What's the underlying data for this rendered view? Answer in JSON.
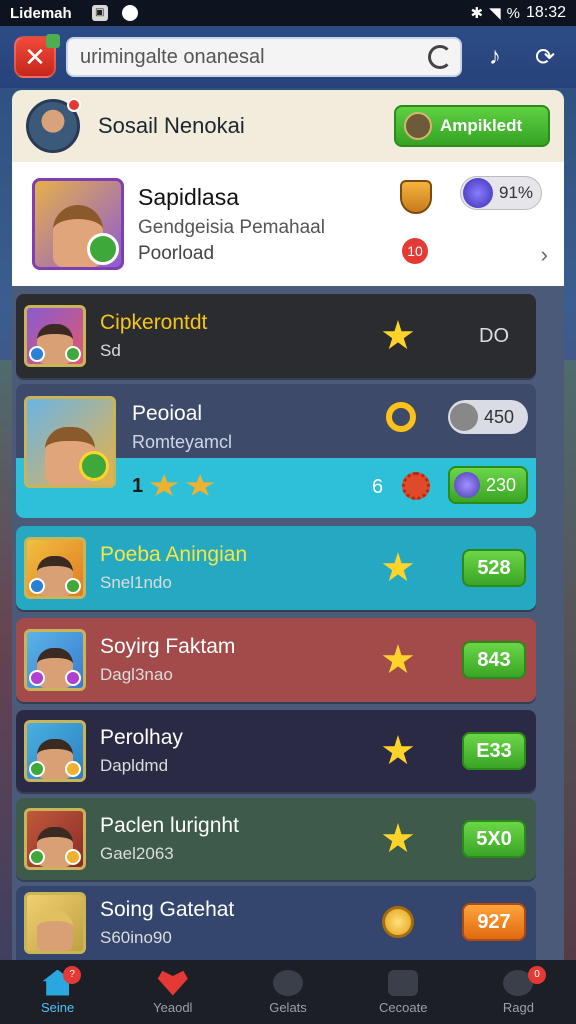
{
  "status_bar": {
    "carrier": "Lidemah",
    "battery_text": "%",
    "time": "18:32"
  },
  "topbar": {
    "search_value": "urimingalte onanesal"
  },
  "profile": {
    "name": "Sosail Nenokai",
    "action_label": "Ampikledt"
  },
  "featured": {
    "title": "Sapidlasa",
    "subtitle": "Gendgeisia Pemahaal",
    "status": "Poorload",
    "pill_value": "91%",
    "badge_count": "10"
  },
  "rows": [
    {
      "title": "Cipkerontdt",
      "subtitle": "Sd",
      "score": "DO",
      "icon": "star-icon",
      "title_color": "#f5c518",
      "bg": "#2a2c30"
    },
    {
      "title": "Poeba Aningian",
      "subtitle": "Snel1ndo",
      "score": "528",
      "icon": "star-icon",
      "title_color": "#f5e642",
      "bg": "#25a9c2"
    },
    {
      "title": "Soyirg Faktam",
      "subtitle": "Dagl3nao",
      "score": "843",
      "icon": "star-icon",
      "title_color": "#ffffff",
      "bg": "#a34a4a"
    },
    {
      "title": "Perolhay",
      "subtitle": "Dapldmd",
      "score": "E33",
      "icon": "star-icon",
      "title_color": "#ffffff",
      "bg": "#2b2a45"
    },
    {
      "title": "Paclen lurignht",
      "subtitle": "Gael2063",
      "score": "5X0",
      "icon": "star-icon",
      "title_color": "#ffffff",
      "bg": "#3d5a4a"
    },
    {
      "title": "Soing Gatehat",
      "subtitle": "S60ino90",
      "score": "927",
      "icon": "coin-icon",
      "title_color": "#ffffff",
      "bg": "#34456e"
    }
  ],
  "expanded": {
    "title": "Peoioal",
    "subtitle": "Romteyamcl",
    "pill_value": "450",
    "lower_left": "1",
    "lower_num": "6",
    "lower_value": "230"
  },
  "nav": [
    {
      "label": "Seine",
      "icon": "home-icon",
      "active": true
    },
    {
      "label": "Yeaodl",
      "icon": "heart-icon",
      "active": false
    },
    {
      "label": "Gelats",
      "icon": "clock-icon",
      "active": false
    },
    {
      "label": "Cecoate",
      "icon": "trophy-icon",
      "active": false
    },
    {
      "label": "Ragd",
      "icon": "profile-icon",
      "active": false
    }
  ],
  "colors": {
    "accent_green": "#3aa526",
    "accent_orange": "#e06a10",
    "active_nav": "#4fc3f7",
    "star": "#ffd42a"
  }
}
